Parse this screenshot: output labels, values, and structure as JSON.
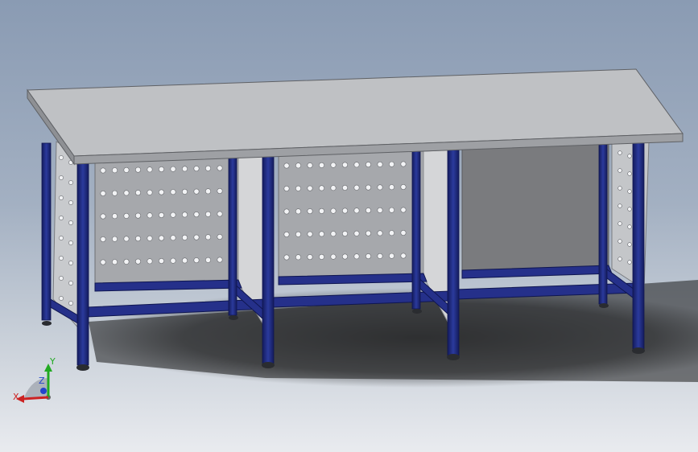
{
  "viewport": {
    "background_top": "#8a9bb3",
    "background_bottom": "#e9ebef"
  },
  "model": {
    "frame_color": "#1f2a7a",
    "top_color": "#b9bbbe",
    "panel_color": "#a9abaf",
    "hole_color": "#f2f3f5"
  },
  "triad": {
    "x_label": "X",
    "y_label": "Y",
    "z_label": "Z",
    "x_color": "#cc2222",
    "y_color": "#22aa22",
    "z_color": "#2244cc"
  }
}
